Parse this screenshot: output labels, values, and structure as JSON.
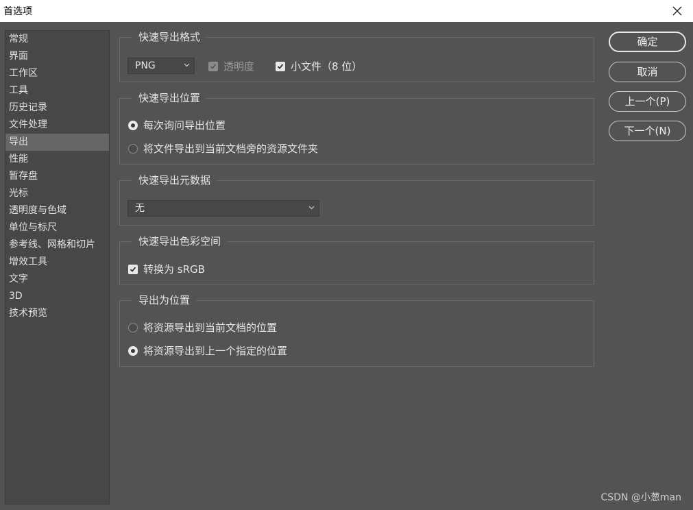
{
  "window": {
    "title": "首选项"
  },
  "sidebar": {
    "items": [
      {
        "label": "常规"
      },
      {
        "label": "界面"
      },
      {
        "label": "工作区"
      },
      {
        "label": "工具"
      },
      {
        "label": "历史记录"
      },
      {
        "label": "文件处理"
      },
      {
        "label": "导出"
      },
      {
        "label": "性能"
      },
      {
        "label": "暂存盘"
      },
      {
        "label": "光标"
      },
      {
        "label": "透明度与色域"
      },
      {
        "label": "单位与标尺"
      },
      {
        "label": "参考线、网格和切片"
      },
      {
        "label": "增效工具"
      },
      {
        "label": "文字"
      },
      {
        "label": "3D"
      },
      {
        "label": "技术预览"
      }
    ],
    "active_index": 6
  },
  "format_group": {
    "legend": "快速导出格式",
    "format_select": "PNG",
    "transparency": {
      "label": "透明度",
      "checked": true,
      "disabled": true
    },
    "small_file": {
      "label": "小文件（8 位）",
      "checked": true
    }
  },
  "location_group": {
    "legend": "快速导出位置",
    "options": [
      {
        "label": "每次询问导出位置",
        "selected": true
      },
      {
        "label": "将文件导出到当前文档旁的资源文件夹",
        "selected": false
      }
    ]
  },
  "metadata_group": {
    "legend": "快速导出元数据",
    "select_value": "无"
  },
  "colorspace_group": {
    "legend": "快速导出色彩空间",
    "convert_srgb": {
      "label": "转换为 sRGB",
      "checked": true
    }
  },
  "export_as_group": {
    "legend": "导出为位置",
    "options": [
      {
        "label": "将资源导出到当前文档的位置",
        "selected": false
      },
      {
        "label": "将资源导出到上一个指定的位置",
        "selected": true
      }
    ]
  },
  "buttons": {
    "ok": "确定",
    "cancel": "取消",
    "prev": "上一个(P)",
    "next": "下一个(N)"
  },
  "watermark": "CSDN @小葱man"
}
